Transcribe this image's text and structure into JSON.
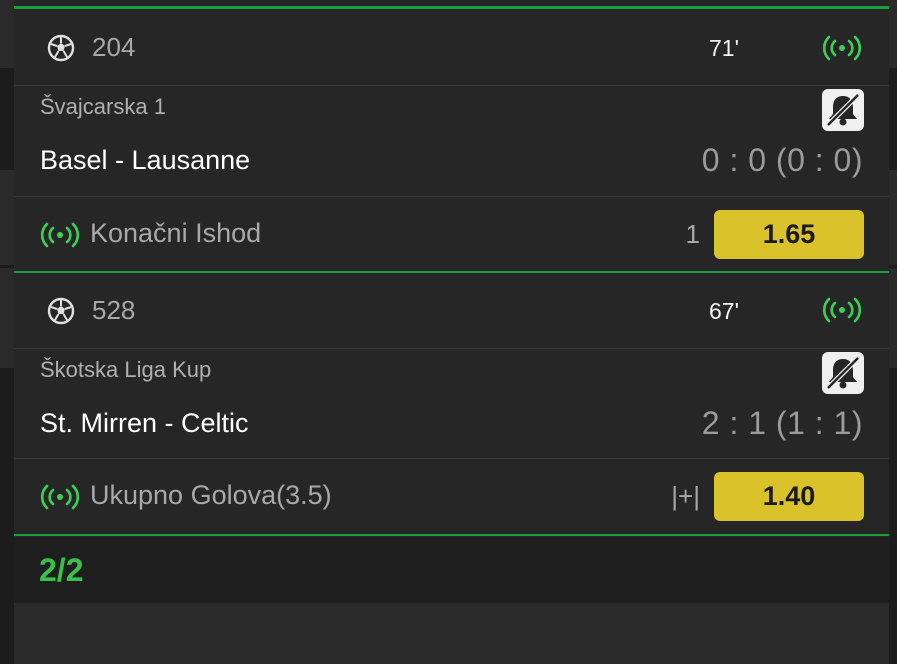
{
  "events": [
    {
      "number": "204",
      "minute": "71'",
      "league": "Švajcarska 1",
      "teams": "Basel - Lausanne",
      "score": "0 : 0 (0 : 0)",
      "market": "Konačni Ishod",
      "outcome": "1",
      "odd": "1.65"
    },
    {
      "number": "528",
      "minute": "67'",
      "league": "Škotska Liga Kup",
      "teams": "St. Mirren - Celtic",
      "score": "2 : 1 (1 : 1)",
      "market": "Ukupno Golova(3.5)",
      "outcome": "|+|",
      "odd": "1.40"
    }
  ],
  "pager": "2/2",
  "icons": {
    "sport": "soccer-ball-icon",
    "live": "live-broadcast-icon",
    "notifications": "bell-off-icon"
  },
  "colors": {
    "accent_green": "#1b9e3e",
    "live_green": "#3ad255",
    "odd_yellow": "#d9c22a",
    "panel": "#262626"
  }
}
